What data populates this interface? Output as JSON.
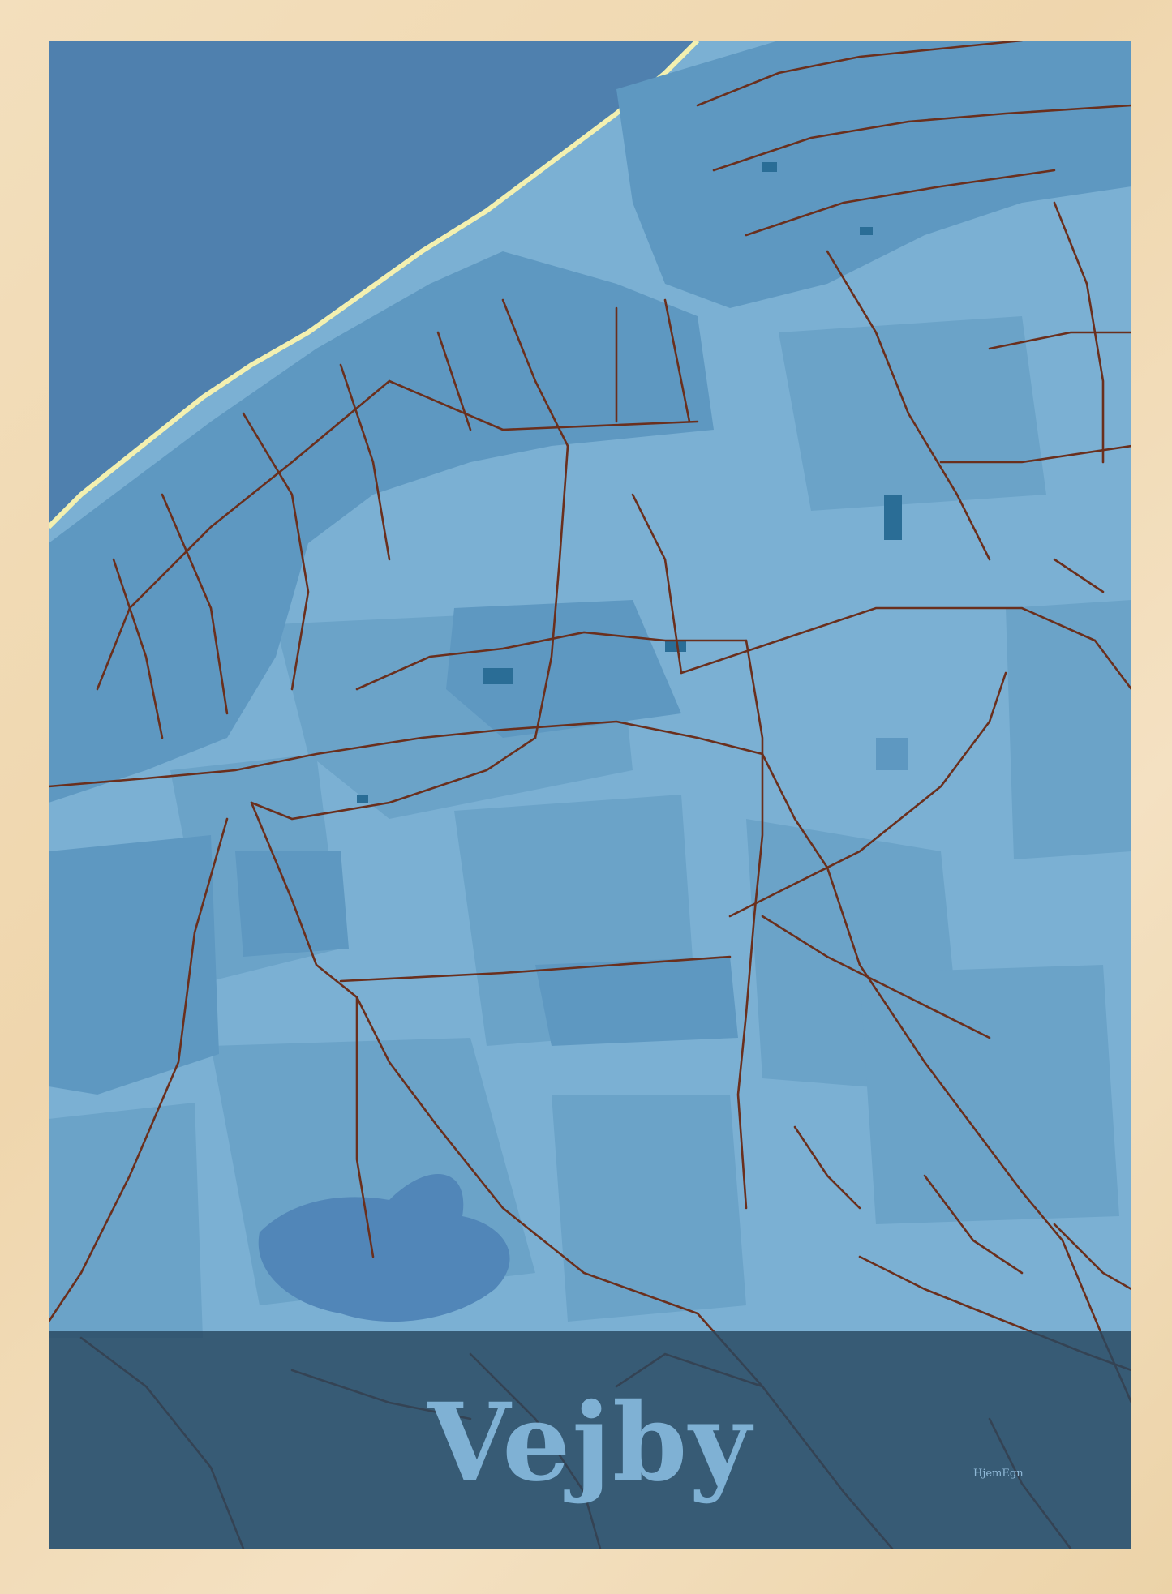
{
  "poster": {
    "place_name": "Vejby",
    "brand_mark": "HjemEgn"
  },
  "colors": {
    "frame": "#efd6ad",
    "sea": "#4f80ae",
    "land": "#7bb0d3",
    "fields": "#6ba3c8",
    "lake": "#5186b8",
    "roads": "#6a2f1d",
    "buildings": "#2a6d96",
    "beach": "#f3f0b0",
    "title_band": "#284860",
    "title_text": "#7fb1d4"
  }
}
